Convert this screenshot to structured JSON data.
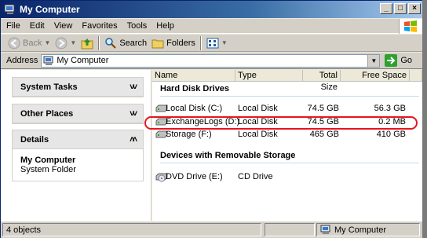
{
  "window": {
    "title": "My Computer"
  },
  "menu": [
    "File",
    "Edit",
    "View",
    "Favorites",
    "Tools",
    "Help"
  ],
  "toolbar": {
    "back": "Back",
    "search": "Search",
    "folders": "Folders"
  },
  "address": {
    "label": "Address",
    "value": "My Computer",
    "go": "Go"
  },
  "tasks": {
    "system_tasks": "System Tasks",
    "other_places": "Other Places",
    "details": "Details",
    "details_title": "My Computer",
    "details_sub": "System Folder"
  },
  "columns": {
    "name": "Name",
    "type": "Type",
    "total_size": "Total Size",
    "free_space": "Free Space"
  },
  "groups": {
    "hdd": "Hard Disk Drives",
    "removable": "Devices with Removable Storage"
  },
  "drives": [
    {
      "name": "Local Disk (C:)",
      "type": "Local Disk",
      "total": "74.5 GB",
      "free": "56.3 GB"
    },
    {
      "name": "ExchangeLogs (D:)",
      "type": "Local Disk",
      "total": "74.5 GB",
      "free": "0.2 MB"
    },
    {
      "name": "Storage (F:)",
      "type": "Local Disk",
      "total": "465 GB",
      "free": "410 GB"
    }
  ],
  "removable": [
    {
      "name": "DVD Drive (E:)",
      "type": "CD Drive"
    }
  ],
  "status": {
    "objects": "4 objects",
    "location": "My Computer"
  },
  "colors": {
    "highlight": "#e8141e",
    "titlebar": "#0a246a"
  }
}
